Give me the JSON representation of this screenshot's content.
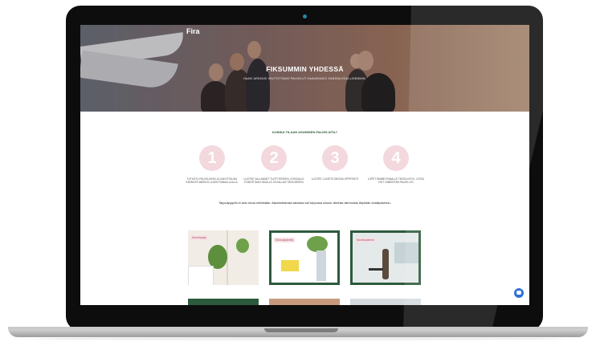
{
  "site": {
    "brand": "Fira",
    "hero_title": "FIKSUMMIN YHDESSÄ",
    "hero_subtitle": "HAAVI ARKEASI HELPOTTAVAT PALVELUT HAAVARADCI KANSSA EDULLISEMMIN."
  },
  "steps_section": {
    "title": "KUINKA TILAAN ASUMISEN PALVELUITA?",
    "steps": [
      {
        "number": "1",
        "text": "TUTUSTU PALVELUIHIN JA ILMOITTAUDU KIINNOSTUNEEKSI, ILMOITTAMALLA ALLA."
      },
      {
        "number": "2",
        "text": "LUOTEE VALLANNET TUOTTEESEEN, KOHDALLE TOIMITETAAN SINULLE JA HALLAN TIEDUSEEEN."
      },
      {
        "number": "3",
        "text": "LUOTEE 1-6VIETS DIESSÄ OPPIFIKETI"
      },
      {
        "number": "4",
        "text": "LOPETTAMME ENNALLE TIEDOLKEEN, JOSSA VOIT VIIMEISTÄÄ PALVELUSI."
      }
    ],
    "note": "Tarjouspyyntö ei sido sinua mihinkään. Askarruttamisa asioissa voit tarjoutua sinuun olleesta alennoista läryhdän chattipalvelun."
  },
  "cards": [
    {
      "tag": "Asuntopaja"
    },
    {
      "tag": "Siivouspalvelu"
    },
    {
      "tag": "Muuttopalvelu"
    }
  ],
  "colors": {
    "accent_green": "#2d5a3d",
    "step_pink": "#f3d8dd",
    "chat_blue": "#2f6fd6"
  },
  "icons": {
    "chat": "chat-bubble-icon",
    "camera": "webcam-dot"
  }
}
